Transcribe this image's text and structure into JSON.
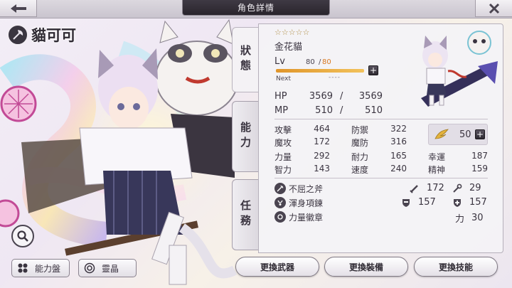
{
  "header": {
    "title": "角色詳情"
  },
  "character": {
    "name": "貓可可",
    "stars": "☆☆☆☆☆",
    "species": "金花貓"
  },
  "level": {
    "label": "Lv",
    "current": "80",
    "slash": "/",
    "max": "80",
    "next_label": "Next",
    "next_value": "----",
    "exp_fraction": 1.0
  },
  "tabs": [
    {
      "label": "狀態"
    },
    {
      "label": "能力"
    },
    {
      "label": "任務"
    }
  ],
  "vitals": {
    "hp": {
      "label": "HP",
      "current": "3569",
      "slash": "/",
      "max": "3569"
    },
    "mp": {
      "label": "MP",
      "current": "510",
      "slash": "/",
      "max": "510"
    }
  },
  "stats": {
    "atk": {
      "label": "攻擊",
      "value": "464"
    },
    "def": {
      "label": "防禦",
      "value": "322"
    },
    "matk": {
      "label": "魔攻",
      "value": "172"
    },
    "mdef": {
      "label": "魔防",
      "value": "316"
    },
    "str": {
      "label": "力量",
      "value": "292"
    },
    "end": {
      "label": "耐力",
      "value": "165"
    },
    "luck": {
      "label": "幸運",
      "value": "187"
    },
    "int": {
      "label": "智力",
      "value": "143"
    },
    "spd": {
      "label": "速度",
      "value": "240"
    },
    "spirit": {
      "label": "精神",
      "value": "159"
    }
  },
  "wing_points": "50",
  "equipment": {
    "weapon": "不屈之斧",
    "armor": "渾身項鍊",
    "accessory": "力量徽章",
    "bonus": {
      "sword": "172",
      "staff": "29",
      "shield": "157",
      "cross": "157",
      "power_label": "力",
      "power": "30"
    }
  },
  "left_buttons": {
    "ability_board": "能力盤",
    "spirit_crystal": "靈晶"
  },
  "actions": {
    "change_weapon": "更換武器",
    "change_equipment": "更換裝備",
    "change_skill": "更換技能"
  },
  "colors": {
    "accent_orange": "#e0952a",
    "level_max": "#d87820",
    "star_gold": "#b08e45"
  },
  "icons": [
    "back-arrow-icon",
    "close-icon",
    "axe-icon",
    "search-icon",
    "grid-icon",
    "crystal-icon",
    "wing-icon",
    "sword-icon",
    "staff-icon",
    "shield-icon",
    "cross-icon"
  ]
}
